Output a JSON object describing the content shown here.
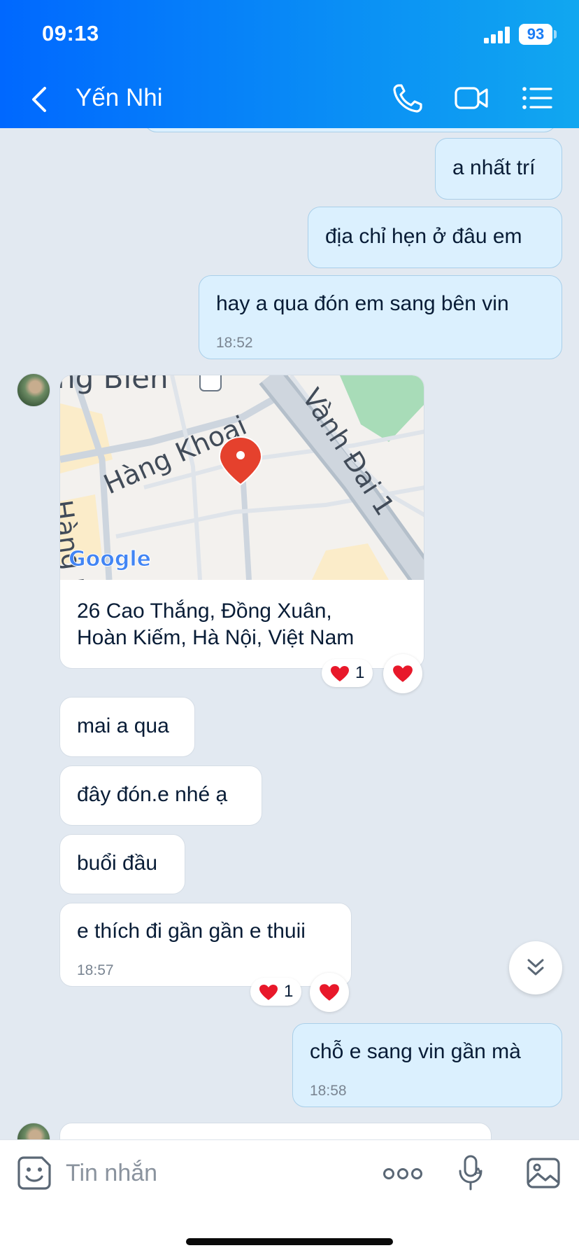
{
  "status_bar": {
    "time": "09:13",
    "battery": "93"
  },
  "header": {
    "title": "Yến Nhi",
    "icons": [
      "back-arrow-icon",
      "phone-icon",
      "video-camera-icon",
      "list-menu-icon"
    ]
  },
  "messages": [
    {
      "from": "me",
      "text": "a nhất trí"
    },
    {
      "from": "me",
      "text": "địa chỉ hẹn ở đâu em"
    },
    {
      "from": "me",
      "text": "hay a qua đón em sang bên vin",
      "time": "18:52"
    },
    {
      "from": "them",
      "type": "location",
      "map_labels": {
        "street_top": "ng Biên",
        "street_main": "Hàng Khoai",
        "road": "Vành Đai 1",
        "street_left": "Hàng L",
        "brand": "Google"
      },
      "address_line1": "26 Cao Thắng, Đồng Xuân,",
      "address_line2": "Hoàn Kiếm, Hà Nội, Việt Nam",
      "reaction_count": "1"
    },
    {
      "from": "them",
      "text": "mai a qua"
    },
    {
      "from": "them",
      "text": "đây đón.e nhé ạ"
    },
    {
      "from": "them",
      "text": "buổi đầu"
    },
    {
      "from": "them",
      "text": "e thích đi gần gần e thuii",
      "time": "18:57",
      "reaction_count": "1"
    },
    {
      "from": "me",
      "text": "chỗ e sang vin gần mà",
      "time": "18:58"
    }
  ],
  "composer": {
    "placeholder": "Tin nhắn",
    "icons": [
      "emoji-sticker-icon",
      "more-options-icon",
      "microphone-icon",
      "image-gallery-icon"
    ]
  },
  "colors": {
    "header_start": "#0068ff",
    "header_end": "#11a7f0",
    "my_bubble": "#dbf0fe",
    "their_bubble": "#ffffff",
    "chat_bg": "#e2e9f1",
    "heart": "#e8182a"
  }
}
